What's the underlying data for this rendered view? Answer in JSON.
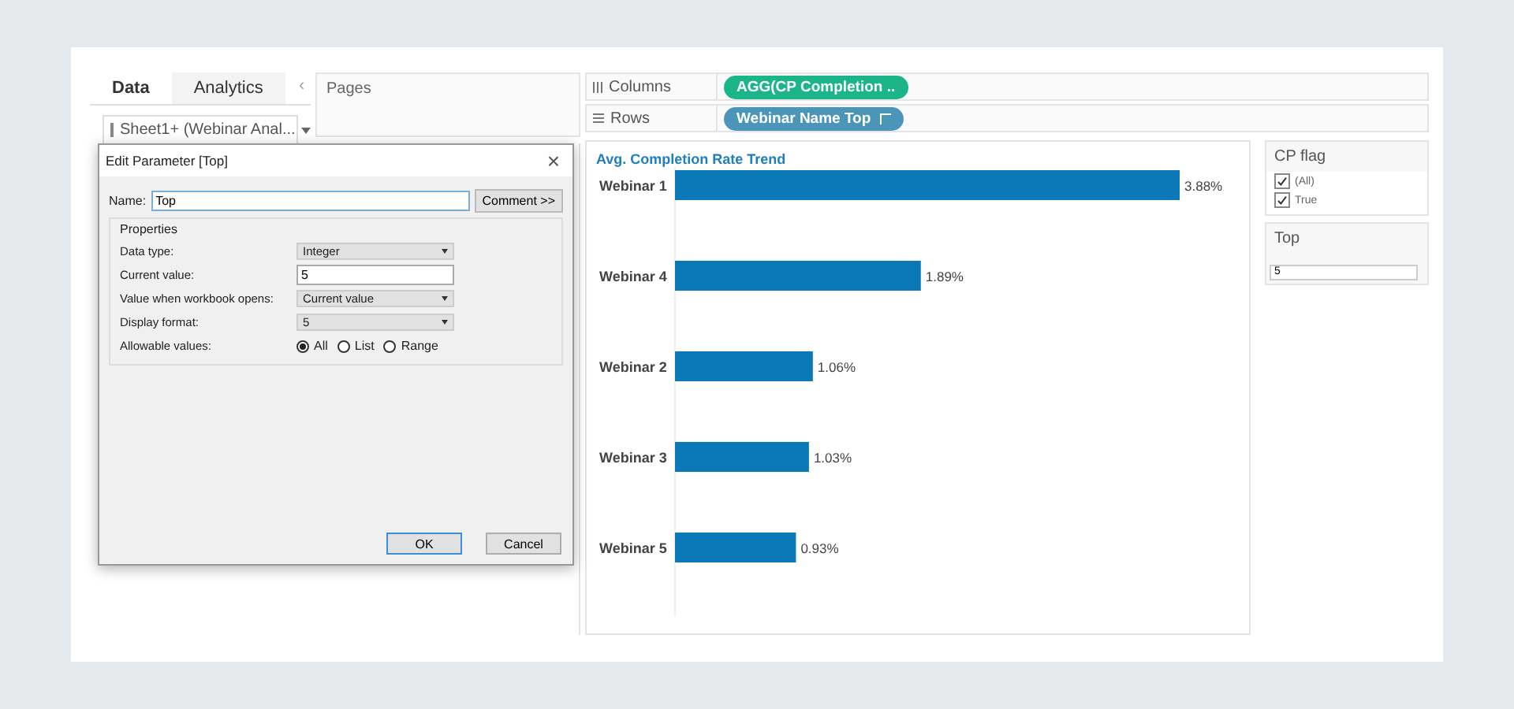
{
  "data_pane": {
    "tabs": [
      {
        "label": "Data",
        "selected": true
      },
      {
        "label": "Analytics",
        "selected": false
      }
    ],
    "collapse": "‹",
    "datasource": "Sheet1+ (Webinar Anal..."
  },
  "pages": {
    "title": "Pages"
  },
  "shelves": [
    {
      "label": "Columns",
      "pill": "AGG(CP Completion ..",
      "kind": "measure"
    },
    {
      "label": "Rows",
      "pill": "Webinar Name Top",
      "kind": "dimension"
    }
  ],
  "chart": {
    "title": "Avg. Completion Rate Trend",
    "chart_data": {
      "type": "bar",
      "orientation": "horizontal",
      "categories": [
        "Webinar 1",
        "Webinar 4",
        "Webinar 2",
        "Webinar 3",
        "Webinar 5"
      ],
      "values": [
        3.88,
        1.89,
        1.06,
        1.03,
        0.93
      ],
      "value_labels": [
        "3.88%",
        "1.89%",
        "1.06%",
        "1.03%",
        "0.93%"
      ]
    }
  },
  "filters": {
    "title": "CP flag",
    "items": [
      {
        "label": "(All)",
        "checked": true
      },
      {
        "label": "True",
        "checked": true
      }
    ]
  },
  "parameter": {
    "title": "Top",
    "value": "5"
  },
  "dialog": {
    "title": "Edit Parameter [Top]",
    "close": "×",
    "name_label": "Name:",
    "name_value": "Top",
    "comment_button": "Comment >>",
    "group": "Properties",
    "fields": [
      {
        "label": "Data type:",
        "kind": "select",
        "value": "Integer"
      },
      {
        "label": "Current value:",
        "kind": "input",
        "value": "5"
      },
      {
        "label": "Value when workbook opens:",
        "kind": "select",
        "value": "Current value"
      },
      {
        "label": "Display format:",
        "kind": "select",
        "value": "5"
      }
    ],
    "allowable_label": "Allowable values:",
    "allowable": [
      {
        "label": "All",
        "selected": true
      },
      {
        "label": "List",
        "selected": false
      },
      {
        "label": "Range",
        "selected": false
      }
    ],
    "buttons": [
      {
        "label": "OK",
        "kind": "default"
      },
      {
        "label": "Cancel",
        "kind": "normal"
      }
    ]
  }
}
